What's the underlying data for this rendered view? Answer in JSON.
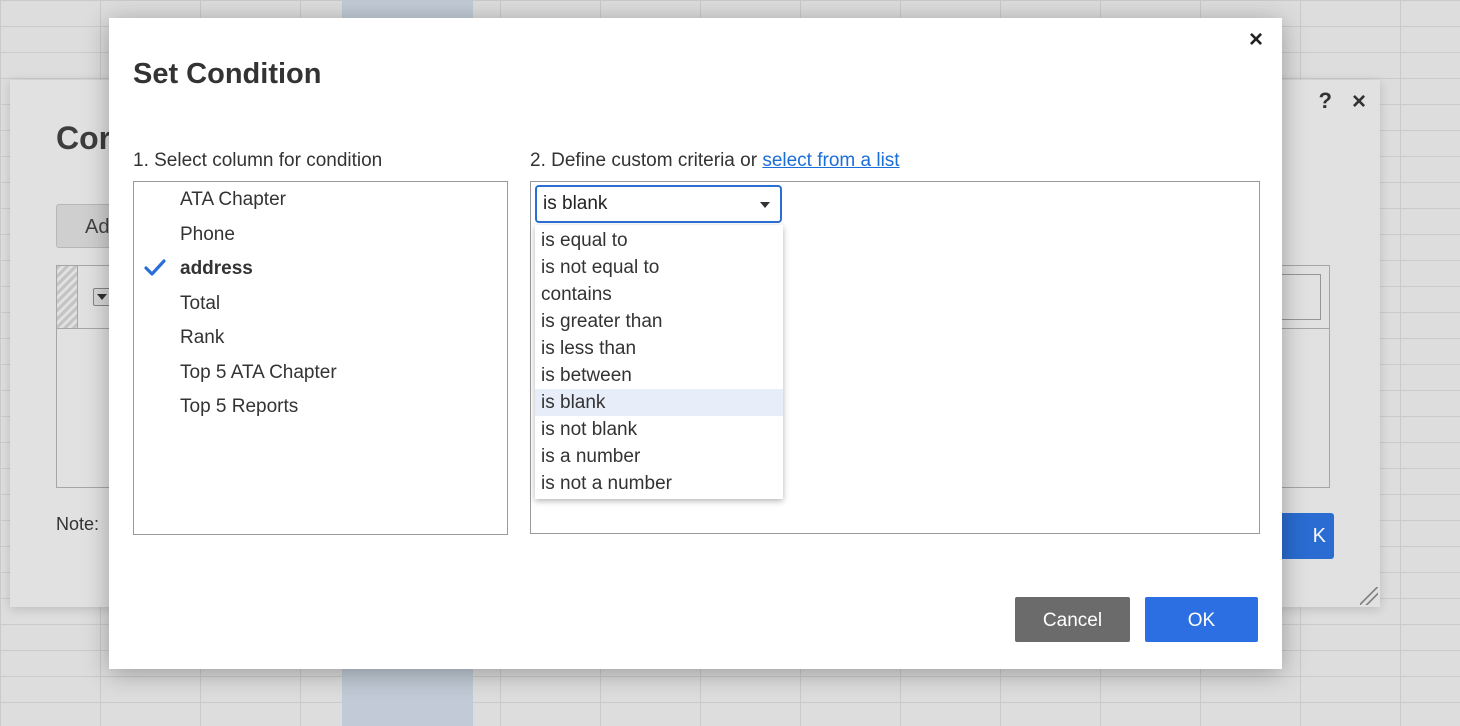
{
  "background": {
    "title": "Cor",
    "add_button": "Ad",
    "note_label": "Note:",
    "ok_button": "K",
    "help_icon": "?",
    "close_icon": "×"
  },
  "dialog": {
    "title": "Set Condition",
    "close_icon": "×",
    "step1_label": "1. Select column for condition",
    "step2_prefix": "2. Define custom criteria or ",
    "step2_link": "select from a list",
    "columns": [
      {
        "label": "ATA Chapter",
        "selected": false
      },
      {
        "label": "Phone",
        "selected": false
      },
      {
        "label": "address",
        "selected": true
      },
      {
        "label": "Total",
        "selected": false
      },
      {
        "label": "Rank",
        "selected": false
      },
      {
        "label": "Top 5 ATA Chapter",
        "selected": false
      },
      {
        "label": "Top 5 Reports",
        "selected": false
      }
    ],
    "criteria_select": {
      "value": "is blank",
      "options": [
        "is equal to",
        "is not equal to",
        "contains",
        "is greater than",
        "is less than",
        "is between",
        "is blank",
        "is not blank",
        "is a number",
        "is not a number"
      ],
      "highlighted": "is blank"
    },
    "cancel_button": "Cancel",
    "ok_button": "OK",
    "accent_color": "#2b6fe3",
    "check_color": "#2b6fd6"
  }
}
